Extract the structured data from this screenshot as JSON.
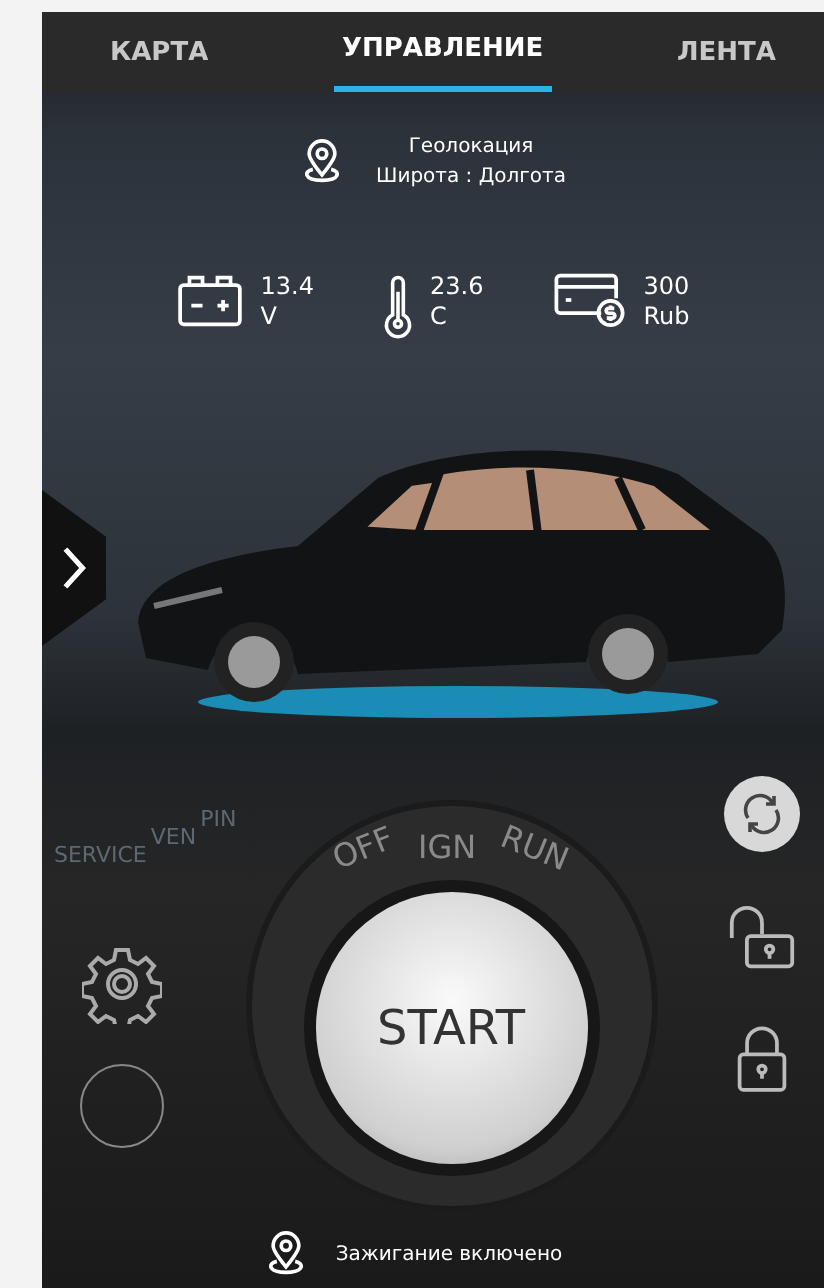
{
  "tabs": [
    {
      "label": "КАРТА",
      "selected": false
    },
    {
      "label": "УПРАВЛЕНИЕ",
      "selected": true
    },
    {
      "label": "ЛЕНТА",
      "selected": false
    }
  ],
  "geolocation": {
    "title": "Геолокация",
    "coordinates": "Широта : Долгота"
  },
  "stats": [
    {
      "kind": "battery",
      "value": "13.4",
      "unit": "V"
    },
    {
      "kind": "temperature",
      "value": "23.6",
      "unit": "C"
    },
    {
      "kind": "balance",
      "value": "300",
      "unit": "Rub"
    }
  ],
  "modes": [
    "SERVICE",
    "VEN",
    "PIN"
  ],
  "key_positions": [
    "OFF",
    "IGN",
    "RUN"
  ],
  "start_button": {
    "label": "START"
  },
  "status": "Зажигание включено"
}
